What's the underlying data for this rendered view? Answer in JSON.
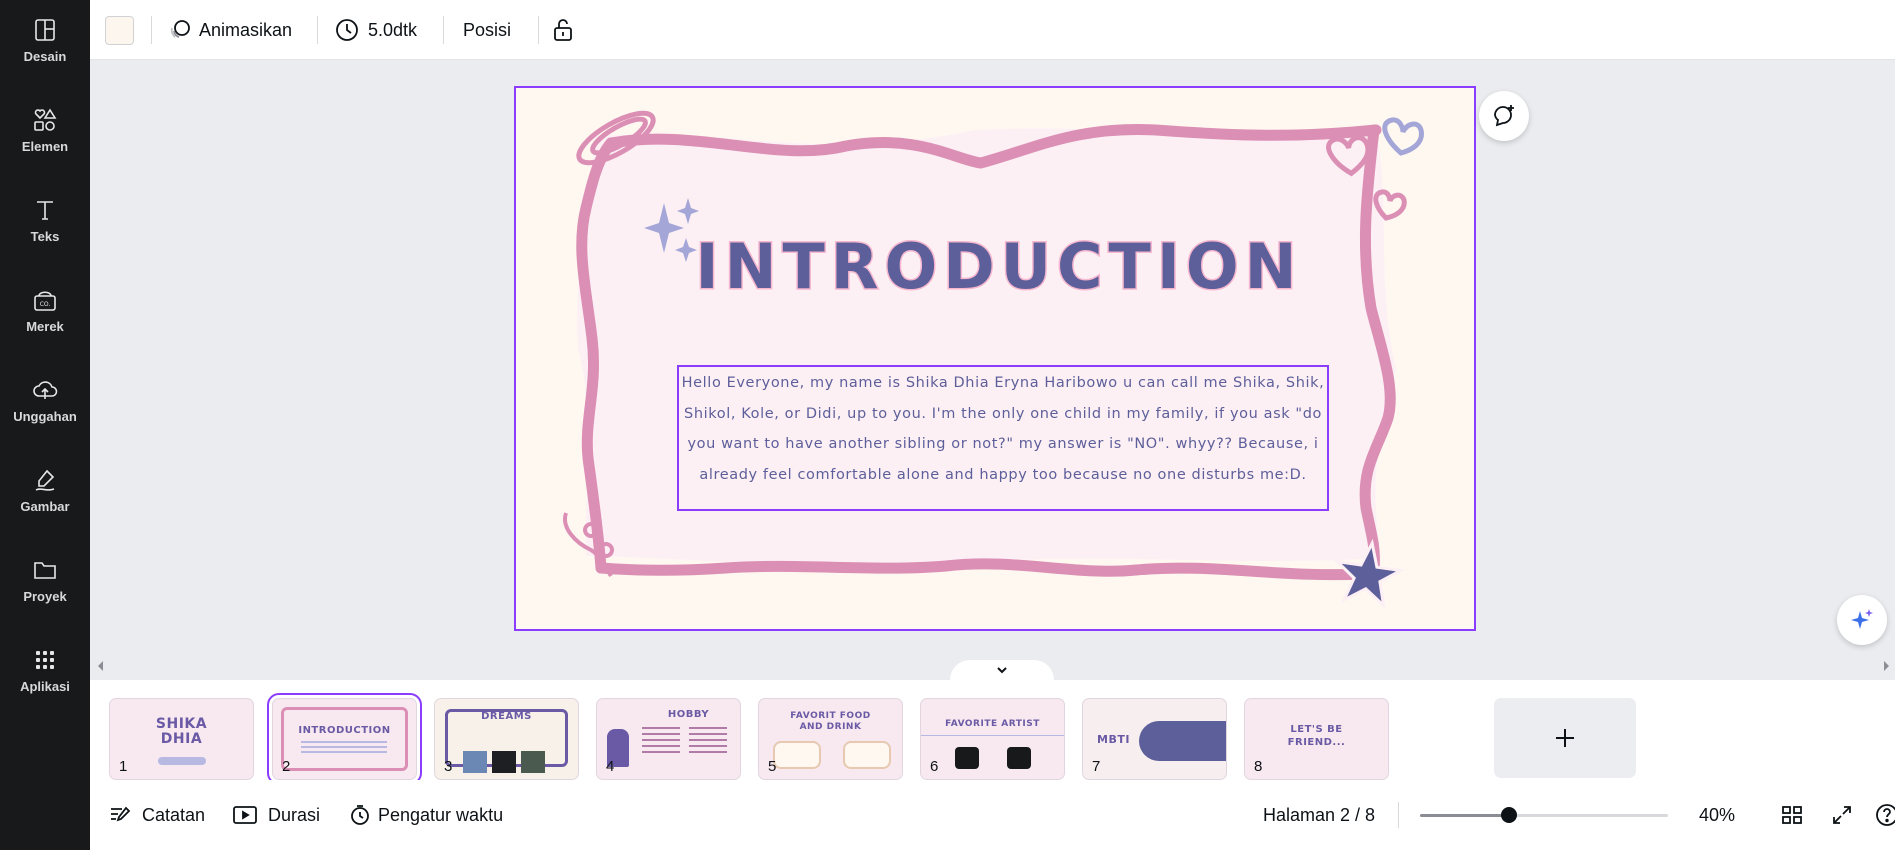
{
  "rail": {
    "items": [
      {
        "label": "Desain",
        "icon": "layout-icon"
      },
      {
        "label": "Elemen",
        "icon": "shapes-icon"
      },
      {
        "label": "Teks",
        "icon": "text-icon"
      },
      {
        "label": "Merek",
        "icon": "brand-icon"
      },
      {
        "label": "Unggahan",
        "icon": "upload-cloud-icon"
      },
      {
        "label": "Gambar",
        "icon": "draw-icon"
      },
      {
        "label": "Proyek",
        "icon": "folder-icon"
      },
      {
        "label": "Aplikasi",
        "icon": "apps-grid-icon"
      }
    ]
  },
  "toolbar": {
    "background_color": "#fdf6ee",
    "animate_label": "Animasikan",
    "duration_label": "5.0dtk",
    "position_label": "Posisi"
  },
  "slide": {
    "title": "INTRODUCTION",
    "body": "Hello Everyone, my name is Shika Dhia Eryna Haribowo u can call me Shika, Shik, Shikol, Kole, or Didi, up to you. I'm the only one child in my family, if you ask \"do you want to have another sibling or not?\" my answer is \"NO\". whyy?? Because, i already feel comfortable alone and happy too because no one disturbs me:D.",
    "background": "#fff8f1",
    "frame_color": "#dc8fb4",
    "title_color": "#5d5f9a"
  },
  "thumbnails": [
    {
      "num": "1",
      "title": "SHIKA DHIA"
    },
    {
      "num": "2",
      "title": "INTRODUCTION"
    },
    {
      "num": "3",
      "title": "DREAMS"
    },
    {
      "num": "4",
      "title": "HOBBY"
    },
    {
      "num": "5",
      "title": "FAVORIT FOOD AND DRINK"
    },
    {
      "num": "6",
      "title": "FAVORITE ARTIST"
    },
    {
      "num": "7",
      "title": "MBTI"
    },
    {
      "num": "8",
      "title": "LET'S BE FRIEND..."
    }
  ],
  "bottombar": {
    "notes_label": "Catatan",
    "duration_label": "Durasi",
    "timer_label": "Pengatur waktu",
    "page_indicator": "Halaman 2 / 8",
    "zoom_label": "40%",
    "zoom_level": 0.35
  },
  "colors": {
    "accent": "#8b3dff",
    "rail": "#18191b",
    "canvas_bg": "#ebecf0"
  }
}
